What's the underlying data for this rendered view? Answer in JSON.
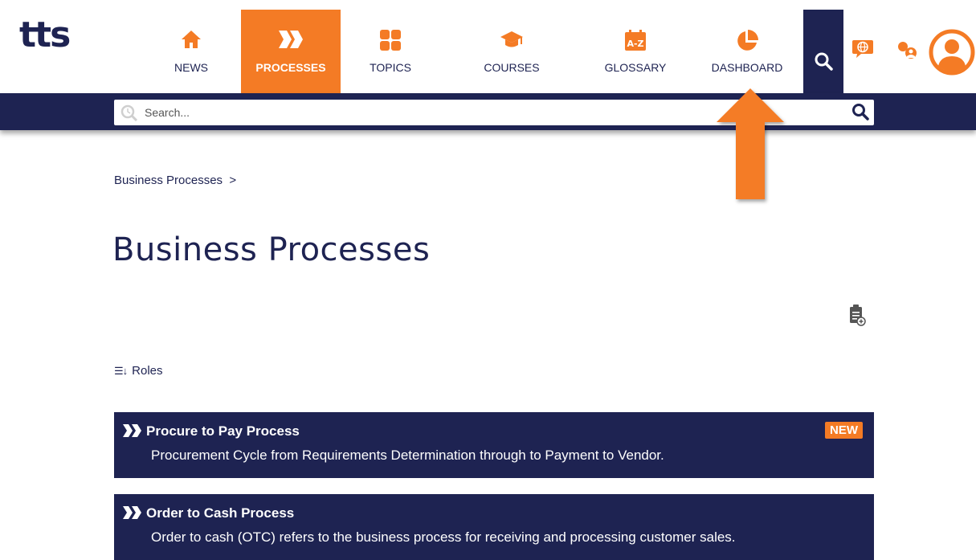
{
  "brand": {
    "logo": "tts",
    "accent": "#f47b25",
    "navy": "#1e2352"
  },
  "nav": {
    "items": [
      {
        "label": "NEWS",
        "icon": "home-icon"
      },
      {
        "label": "PROCESSES",
        "icon": "process-chevron-icon",
        "active": true
      },
      {
        "label": "TOPICS",
        "icon": "grid-icon"
      },
      {
        "label": "COURSES",
        "icon": "graduation-cap-icon"
      },
      {
        "label": "GLOSSARY",
        "icon": "a-z-icon"
      },
      {
        "label": "DASHBOARD",
        "icon": "pie-chart-icon"
      }
    ],
    "right_icons": [
      "search-icon",
      "language-globe-icon",
      "roles-icon",
      "user-avatar-icon"
    ]
  },
  "search": {
    "placeholder": "Search..."
  },
  "breadcrumb": "Business Processes  >",
  "page_title": "Business Processes",
  "roles_label": "Roles",
  "processes": [
    {
      "title": "Procure to Pay Process",
      "badge": "NEW",
      "description": "Procurement Cycle from Requirements Determination through to Payment to Vendor."
    },
    {
      "title": "Order to Cash Process",
      "badge": "",
      "description": "Order to cash (OTC) refers to the business process for receiving and processing customer sales."
    }
  ]
}
